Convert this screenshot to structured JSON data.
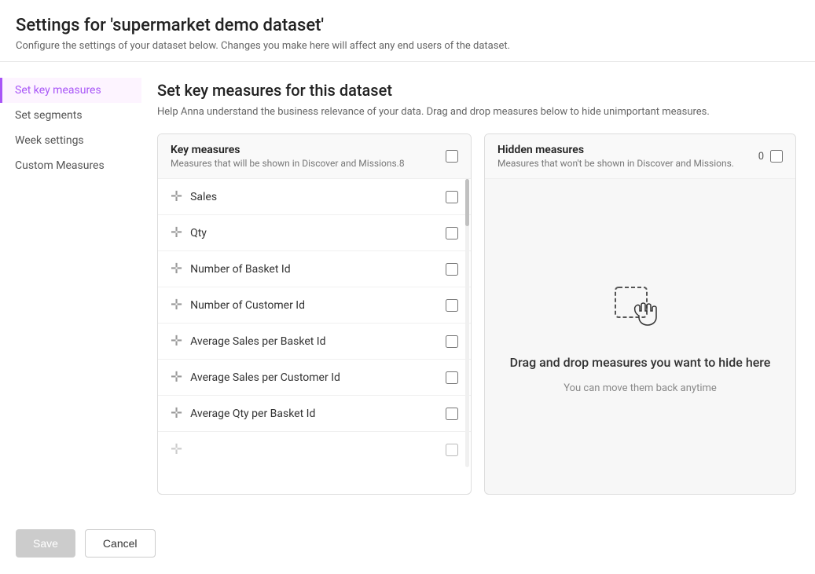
{
  "page": {
    "title": "Settings for 'supermarket demo dataset'",
    "subtitle": "Configure the settings of your dataset below. Changes you make here will affect any end users of the dataset."
  },
  "sidebar": {
    "items": [
      {
        "id": "set-key-measures",
        "label": "Set key measures",
        "active": true
      },
      {
        "id": "set-segments",
        "label": "Set segments",
        "active": false
      },
      {
        "id": "week-settings",
        "label": "Week settings",
        "active": false
      },
      {
        "id": "custom-measures",
        "label": "Custom Measures",
        "active": false
      }
    ]
  },
  "content": {
    "title": "Set key measures for this dataset",
    "description": "Help Anna understand the business relevance of your data. Drag and drop measures below to hide unimportant measures."
  },
  "key_measures_panel": {
    "title": "Key measures",
    "subtitle": "Measures that will be shown in Discover and Missions.",
    "count": "8",
    "items": [
      {
        "name": "Sales"
      },
      {
        "name": "Qty"
      },
      {
        "name": "Number of Basket Id"
      },
      {
        "name": "Number of Customer Id"
      },
      {
        "name": "Average Sales per Basket Id"
      },
      {
        "name": "Average Sales per Customer Id"
      },
      {
        "name": "Average Qty per Basket Id"
      }
    ]
  },
  "hidden_measures_panel": {
    "title": "Hidden measures",
    "subtitle": "Measures that won't be shown in Discover and Missions.",
    "count": "0",
    "drop_text_main": "Drag and drop measures you want to hide here",
    "drop_text_sub": "You can move them back anytime"
  },
  "footer": {
    "save_label": "Save",
    "cancel_label": "Cancel"
  },
  "icons": {
    "drag_handle": "⊕",
    "checkbox_empty": ""
  }
}
